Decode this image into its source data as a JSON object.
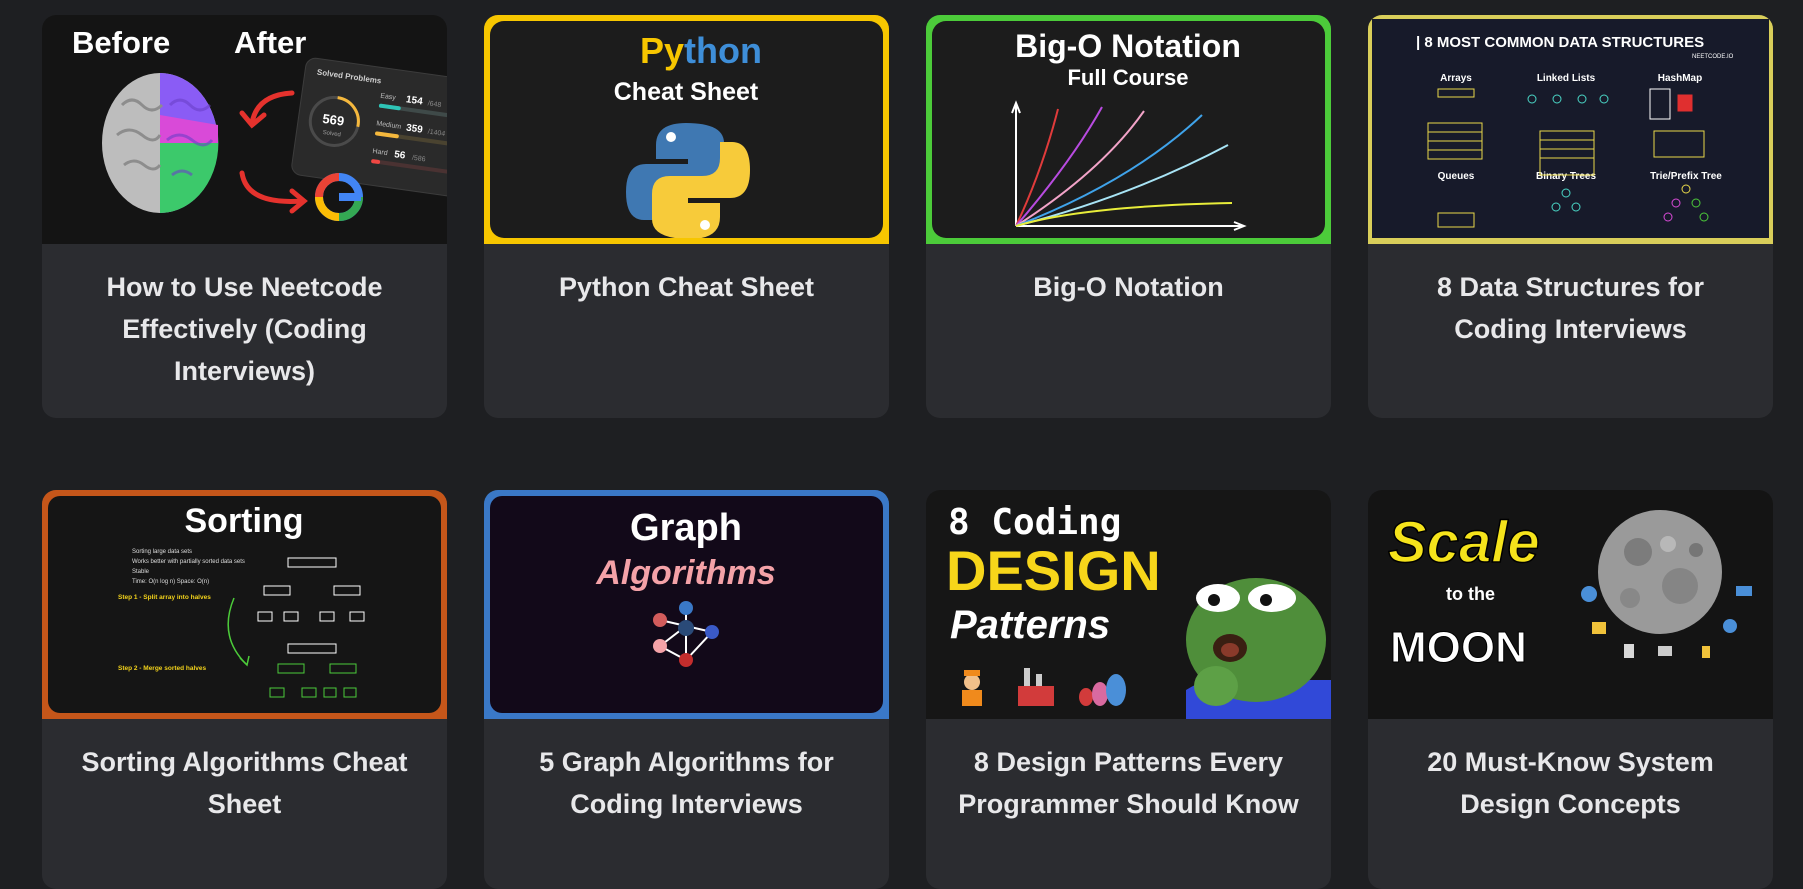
{
  "cards": [
    {
      "title": "How to Use Neetcode Effectively (Coding Interviews)",
      "thumb": {
        "before": "Before",
        "after": "After",
        "panel_title": "Solved Problems",
        "solved_count": "569",
        "solved_label": "Solved",
        "rows": [
          {
            "label": "Easy",
            "value": "154",
            "total": "/648",
            "color": "#2ec4b6",
            "progress": 0.24
          },
          {
            "label": "Medium",
            "value": "359",
            "total": "/1404",
            "color": "#f5b83d",
            "progress": 0.26
          },
          {
            "label": "Hard",
            "value": "56",
            "total": "/586",
            "color": "#ef4743",
            "progress": 0.1
          }
        ],
        "logo_text": "G"
      }
    },
    {
      "title": "Python Cheat Sheet",
      "thumb": {
        "word_a": "Py",
        "word_b": "thon",
        "subtitle": "Cheat Sheet",
        "border_color": "#f7c600"
      }
    },
    {
      "title": "Big-O Notation",
      "thumb": {
        "heading": "Big-O Notation",
        "subtitle": "Full Course",
        "border_color": "#4ccb3a"
      }
    },
    {
      "title": "8 Data Structures for Coding Interviews",
      "thumb": {
        "heading": "| 8 MOST COMMON DATA STRUCTURES",
        "brand": "NEETCODE.IO",
        "sections": [
          "Arrays",
          "Linked Lists",
          "HashMap",
          "Queues",
          "Binary Trees",
          "Trie/Prefix Tree"
        ],
        "border_color": "#d9ce5a"
      }
    },
    {
      "title": "Sorting Algorithms Cheat Sheet",
      "thumb": {
        "heading": "Sorting",
        "bullets": [
          "Sorting large data sets",
          "Works better with partially sorted data sets",
          "Stable",
          "Time: O(n log n) Space: O(n)"
        ],
        "step1": "Step 1 - Split array into halves",
        "step2": "Step 2 - Merge sorted halves",
        "border_color": "#c5561a"
      }
    },
    {
      "title": "5 Graph Algorithms for Coding Interviews",
      "thumb": {
        "heading": "Graph",
        "subtitle": "Algorithms",
        "border_color": "#3a78c7"
      }
    },
    {
      "title": "8 Design Patterns Every Programmer Should Know",
      "thumb": {
        "line1": "8 Coding",
        "line2": "DESIGN",
        "line3": "Patterns"
      }
    },
    {
      "title": "20 Must-Know System Design Concepts",
      "thumb": {
        "line1": "Scale",
        "line2": "to the",
        "line3": "MOON"
      }
    }
  ]
}
